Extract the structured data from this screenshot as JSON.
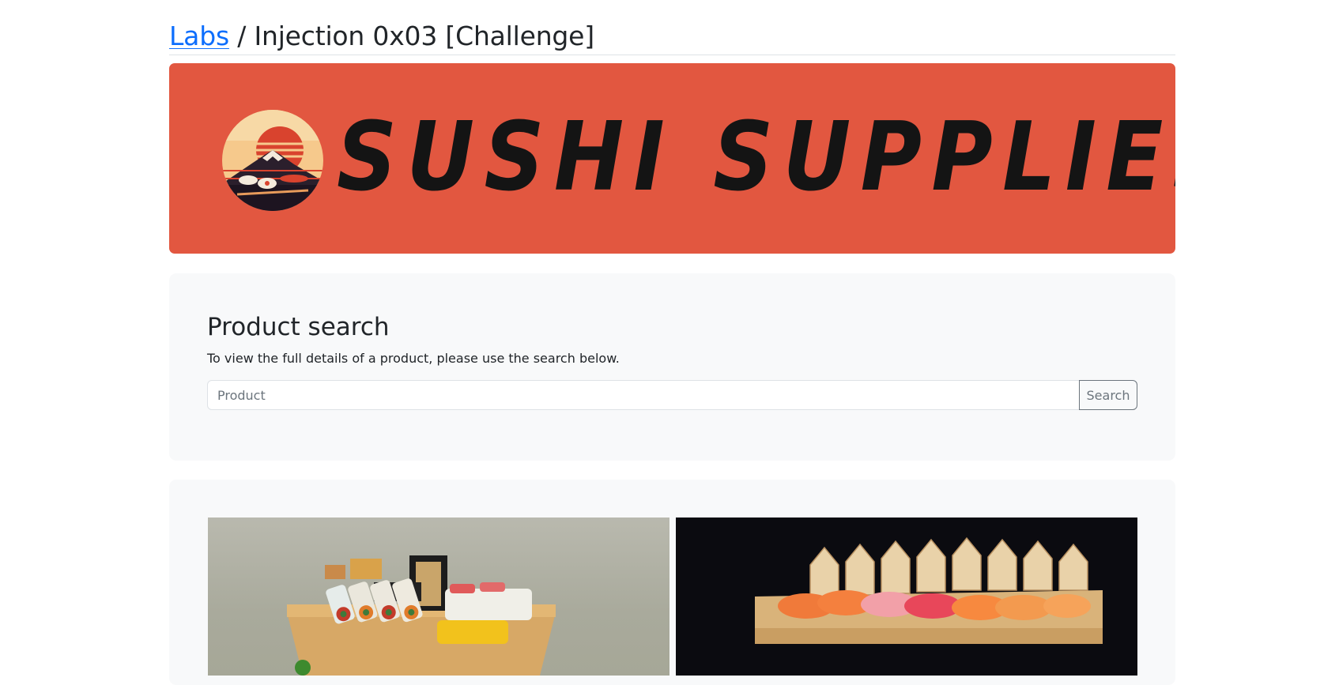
{
  "header": {
    "breadcrumb_link": "Labs",
    "breadcrumb_rest": " / Injection 0x03 [Challenge]"
  },
  "banner": {
    "brand_text": "SUSHI SUPPLIES",
    "background_color": "#e25740"
  },
  "search": {
    "title": "Product search",
    "description": "To view the full details of a product, please use the search below.",
    "input_placeholder": "Product",
    "input_value": "",
    "button_label": "Search"
  },
  "products": {
    "images": [
      "sushi-platter-image",
      "nigiri-board-image"
    ]
  },
  "colors": {
    "link": "#0d6efd",
    "card_bg": "#f8f9fa",
    "text": "#212529",
    "muted": "#6c757d"
  }
}
